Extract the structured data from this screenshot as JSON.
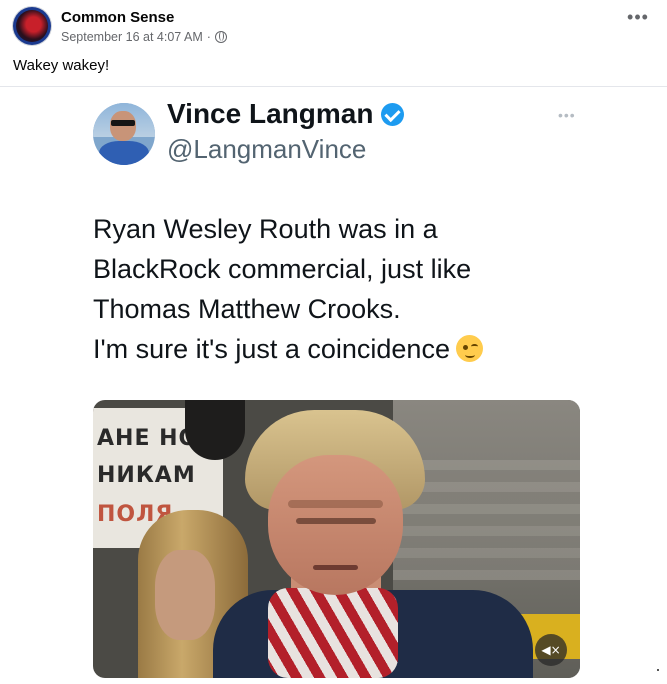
{
  "post": {
    "page_name": "Common Sense",
    "timestamp": "September 16 at 4:07 AM",
    "separator": "·",
    "more_label": "•••",
    "caption": "Wakey wakey!"
  },
  "tweet": {
    "display_name": "Vince Langman",
    "handle": "@LangmanVince",
    "more_label": "•••",
    "lines": [
      "Ryan Wesley Routh was in a",
      "BlackRock commercial, just like",
      "Thomas Matthew Crooks.",
      "I'm sure it's just a coincidence"
    ]
  },
  "video": {
    "sign_lines": [
      "АНЕ НО",
      "НИКАМ",
      "ПОЛЯ"
    ],
    "mute_label": "◀×"
  },
  "colors": {
    "verified": "#1d9bf0",
    "page_name": "#050505",
    "meta": "#65676b"
  }
}
